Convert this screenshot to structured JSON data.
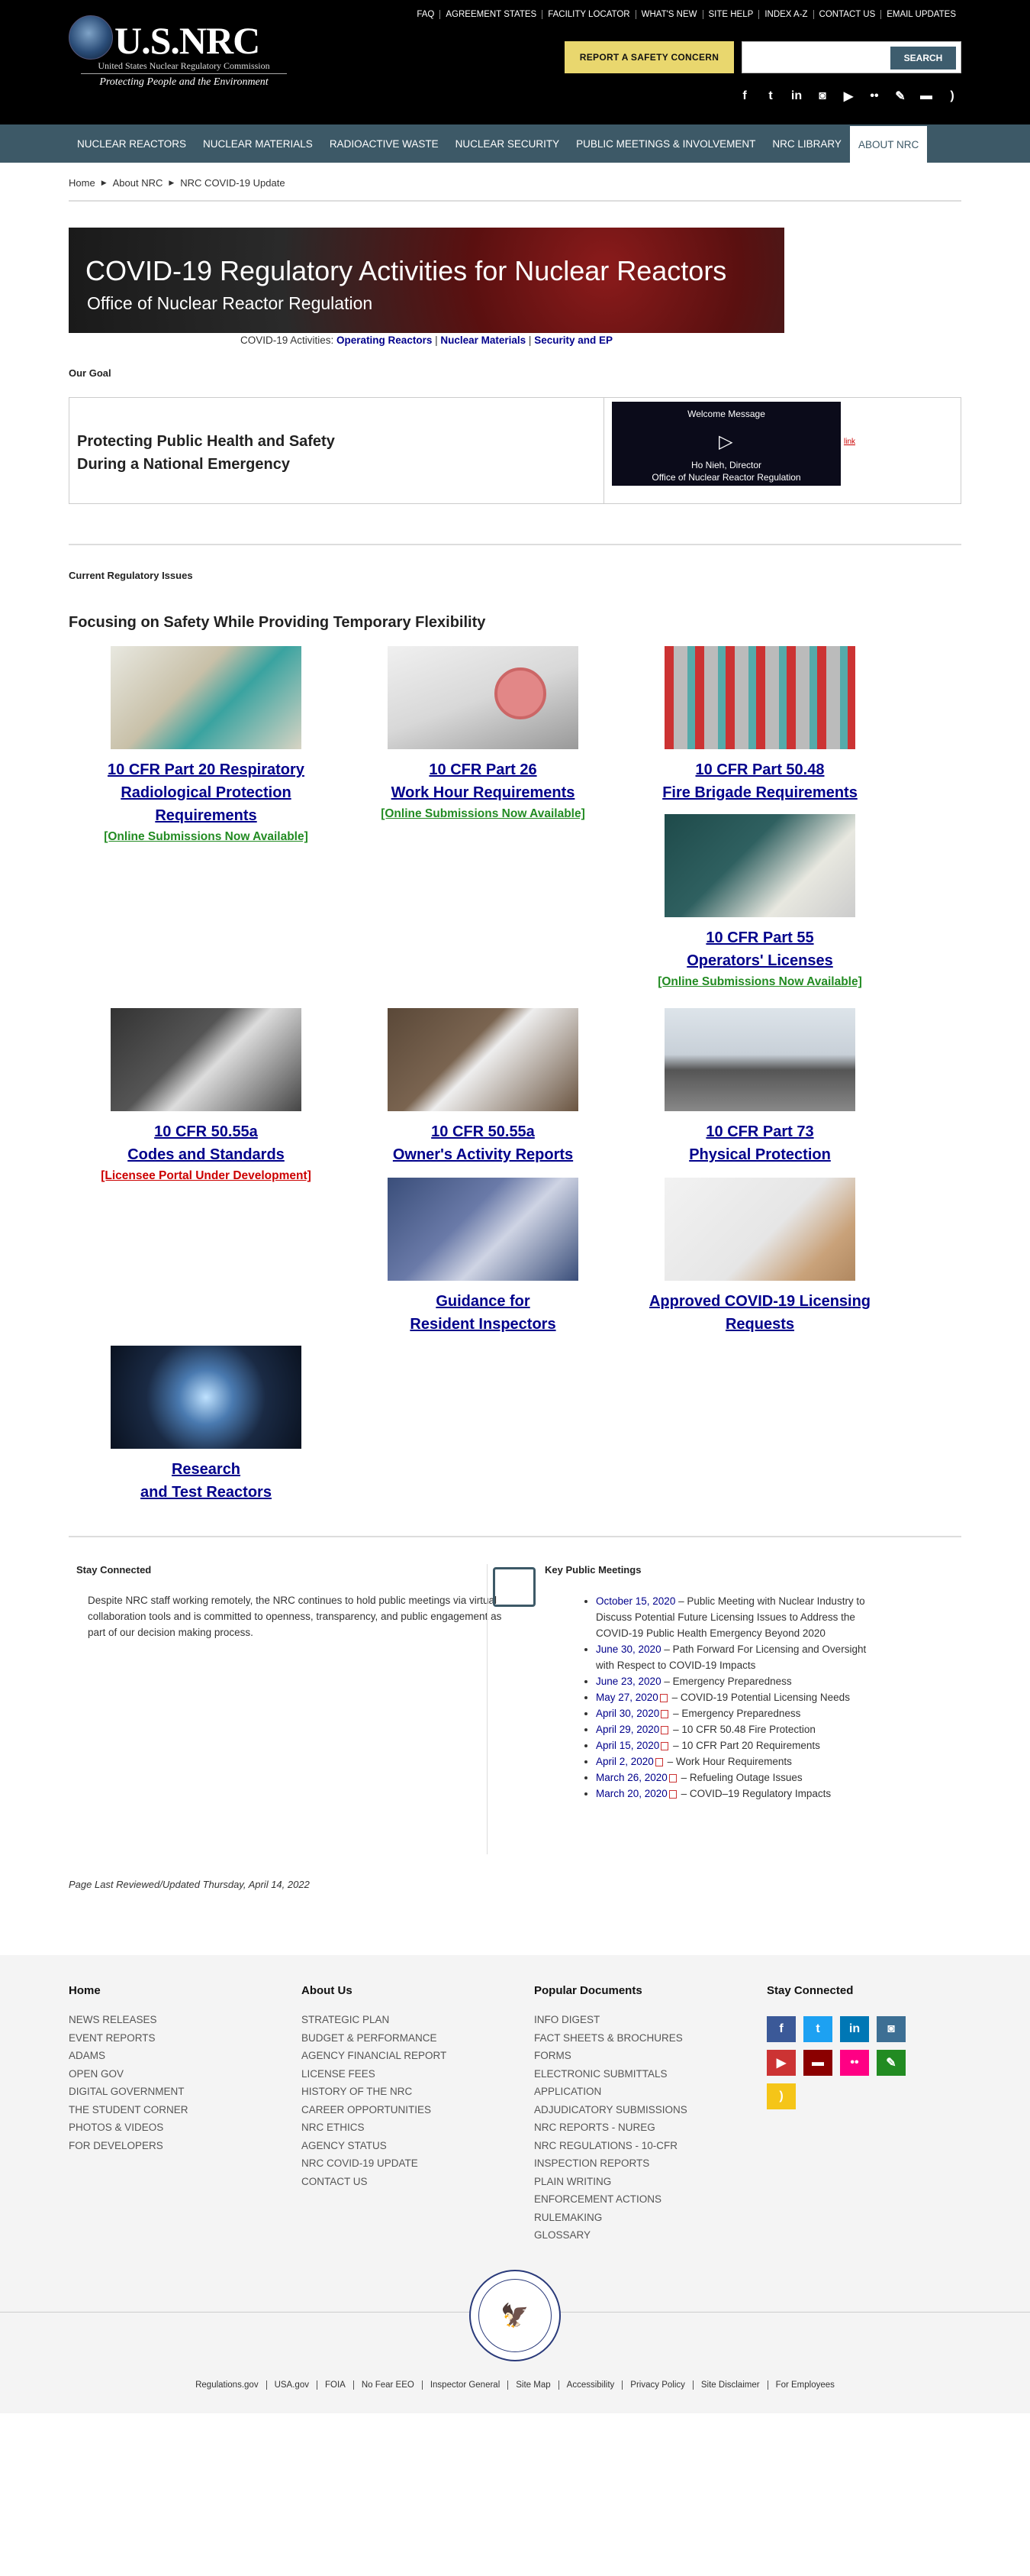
{
  "header": {
    "logo_text": "U.S.NRC",
    "logo_subtitle": "United States Nuclear Regulatory Commission",
    "logo_tagline": "Protecting People and the Environment",
    "top_links": [
      "FAQ",
      "Agreement States",
      "Facility Locator",
      "What's New",
      "Site Help",
      "Index A-Z",
      "Contact Us",
      "Email Updates"
    ],
    "report_button": "REPORT A SAFETY CONCERN",
    "search_placeholder": "",
    "search_button": "SEARCH",
    "social_icons": [
      "facebook-icon",
      "twitter-icon",
      "linkedin-icon",
      "instagram-icon",
      "youtube-icon",
      "flickr-icon",
      "blog-icon",
      "comment-icon",
      "rss-icon"
    ]
  },
  "nav": [
    "Nuclear Reactors",
    "Nuclear Materials",
    "Radioactive Waste",
    "Nuclear Security",
    "Public Meetings & Involvement",
    "NRC Library",
    "About NRC"
  ],
  "breadcrumb": [
    "Home",
    "About NRC",
    "NRC COVID-19 Update"
  ],
  "banner": {
    "title": "COVID-19 Regulatory Activities for Nuclear Reactors",
    "subtitle": "Office of Nuclear Reactor Regulation",
    "links_prefix": "COVID-19 Activities: ",
    "links": [
      "Operating Reactors",
      "Nuclear Materials",
      "Security and EP"
    ]
  },
  "goal": {
    "heading": "Our Goal",
    "line1": "Protecting Public Health and Safety",
    "line2": "During a National Emergency",
    "video_title": "Welcome Message",
    "video_name": "Ho Nieh, Director",
    "video_office": "Office of Nuclear Reactor Regulation",
    "video_link": "link"
  },
  "issues": {
    "heading": "Current Regulatory Issues",
    "subheading": "Focusing on Safety While Providing Temporary Flexibility",
    "cards": [
      {
        "t1": "10 CFR Part 20 Respiratory",
        "t2": "Radiological Protection",
        "t3": "Requirements",
        "status": "[Online Submissions Now Available]"
      },
      {
        "t1": "10 CFR Part 26",
        "t2": "Work Hour Requirements",
        "status": "[Online Submissions Now Available]"
      },
      {
        "t1": "10 CFR Part 50.48",
        "t2": "Fire Brigade Requirements"
      },
      {
        "t1": "10 CFR Part 55",
        "t2": "Operators' Licenses",
        "status": "[Online Submissions Now Available]"
      },
      {
        "t1": "10 CFR 50.55a",
        "t2": "Codes and Standards",
        "status": "[Licensee Portal Under Development]"
      },
      {
        "t1": "10 CFR 50.55a",
        "t2": "Owner's Activity Reports"
      },
      {
        "t1": "10 CFR Part 73",
        "t2": "Physical Protection"
      },
      {
        "t1": "Guidance for",
        "t2": "Resident Inspectors"
      },
      {
        "t1": "Approved COVID-19 Licensing",
        "t2": "Requests"
      },
      {
        "t1": "Research",
        "t2": "and Test Reactors"
      }
    ]
  },
  "stay": {
    "heading": "Stay Connected",
    "text": "Despite NRC staff working remotely, the NRC continues to hold public meetings via virtual collaboration tools and is committed to openness, transparency, and public engagement as part of our decision making process."
  },
  "meetings": {
    "heading": "Key Public Meetings",
    "items": [
      {
        "date": "October 15, 2020",
        "text": " – Public Meeting with Nuclear Industry to Discuss Potential Future Licensing Issues to Address the COVID-19 Public Health Emergency Beyond 2020"
      },
      {
        "date": "June 30, 2020",
        "text": " – Path Forward For Licensing and Oversight with Respect to COVID-19 Impacts"
      },
      {
        "date": "June 23, 2020",
        "text": " – Emergency Preparedness"
      },
      {
        "date": "May 27, 2020",
        "text": " – COVID-19 Potential Licensing Needs",
        "pdf": true
      },
      {
        "date": "April 30, 2020",
        "text": " – Emergency Preparedness",
        "pdf": true
      },
      {
        "date": "April 29, 2020",
        "text": " – 10 CFR 50.48 Fire Protection",
        "pdf": true
      },
      {
        "date": "April 15, 2020",
        "text": " – 10 CFR Part 20 Requirements",
        "pdf": true
      },
      {
        "date": "April 2, 2020",
        "text": " – Work Hour Requirements",
        "pdf": true
      },
      {
        "date": "March 26, 2020",
        "text": " – Refueling Outage Issues",
        "pdf": true
      },
      {
        "date": "March 20, 2020",
        "text": " – COVID–19 Regulatory Impacts",
        "pdf": true
      }
    ]
  },
  "reviewed": "Page Last Reviewed/Updated Thursday, April 14, 2022",
  "footer": {
    "col1": {
      "heading": "Home",
      "items": [
        "News Releases",
        "Event Reports",
        "ADAMS",
        "Open Gov",
        "Digital Government",
        "The Student Corner",
        "Photos & Videos",
        "For Developers"
      ]
    },
    "col2": {
      "heading": "About Us",
      "items": [
        "Strategic Plan",
        "Budget & Performance",
        "Agency Financial Report",
        "License Fees",
        "History of the NRC",
        "Career Opportunities",
        "NRC Ethics",
        "Agency Status",
        "NRC COVID-19 Update",
        "Contact Us"
      ]
    },
    "col3": {
      "heading": "Popular Documents",
      "items": [
        "Info Digest",
        "Fact Sheets & Brochures",
        "Forms",
        "Electronic Submittals",
        "Application",
        "Adjudicatory Submissions",
        "NRC Reports - NUREG",
        "NRC Regulations - 10-CFR",
        "Inspection Reports",
        "Plain Writing",
        "Enforcement Actions",
        "Rulemaking",
        "Glossary"
      ]
    },
    "col4": {
      "heading": "Stay Connected"
    },
    "social_colors": [
      "#3b5998",
      "#1da1f2",
      "#0077b5",
      "#3d6f94",
      "#cc3333",
      "#8b0000",
      "#ff0084",
      "#228b22",
      "#f5c518"
    ],
    "bottom_links": [
      "Regulations.gov",
      "USA.gov",
      "FOIA",
      "No Fear EEO",
      "Inspector General",
      "Site Map",
      "Accessibility",
      "Privacy Policy",
      "Site Disclaimer",
      "For Employees"
    ]
  }
}
